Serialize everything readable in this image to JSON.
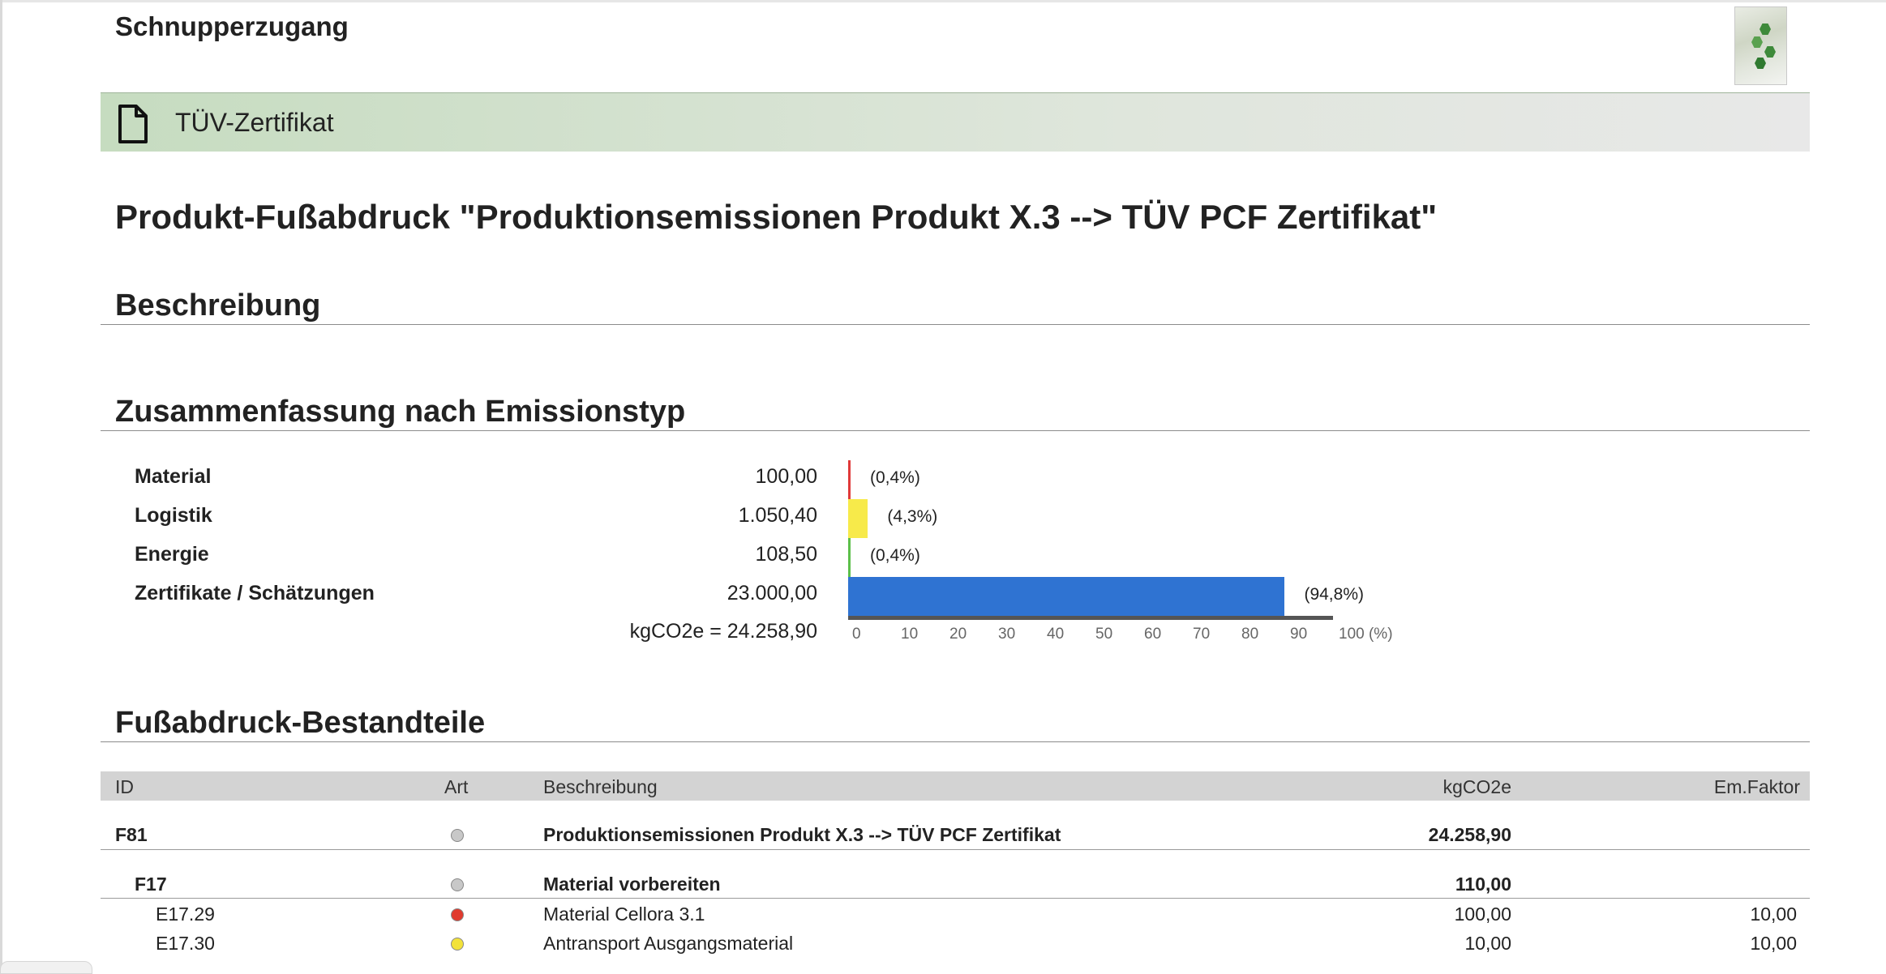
{
  "header": {
    "account_title": "Schnupperzugang"
  },
  "document": {
    "type_label": "TÜV-Zertifikat"
  },
  "page_title": "Produkt-Fußabdruck \"Produktionsemissionen Produkt X.3 --> TÜV PCF Zertifikat\"",
  "sections": {
    "description": "Beschreibung",
    "summary": "Zusammenfassung nach Emissionstyp",
    "components": "Fußabdruck-Bestandteile"
  },
  "summary": {
    "rows": [
      {
        "label": "Material",
        "value": "100,00",
        "percent_text": "(0,4%)",
        "percent": 0.4,
        "color": "#e03a3a"
      },
      {
        "label": "Logistik",
        "value": "1.050,40",
        "percent_text": "(4,3%)",
        "percent": 4.3,
        "color": "#f7ea4a"
      },
      {
        "label": "Energie",
        "value": "108,50",
        "percent_text": "(0,4%)",
        "percent": 0.4,
        "color": "#5cbf4a"
      },
      {
        "label": "Zertifikate / Schätzungen",
        "value": "23.000,00",
        "percent_text": "(94,8%)",
        "percent": 94.8,
        "color": "#2f73d2"
      }
    ],
    "total": "kgCO2e = 24.258,90",
    "axis_ticks": [
      "0",
      "10",
      "20",
      "30",
      "40",
      "50",
      "60",
      "70",
      "80",
      "90",
      "100 (%)"
    ]
  },
  "table": {
    "columns": [
      "ID",
      "Art",
      "Beschreibung",
      "kgCO2e",
      "Em.Faktor"
    ],
    "rows": [
      {
        "id": "F81",
        "art_color": "#c8c8c8",
        "description": "Produktionsemissionen Produkt X.3 --> TÜV PCF Zertifikat",
        "kgco2e": "24.258,90",
        "factor": ""
      },
      {
        "id": "F17",
        "art_color": "#c8c8c8",
        "description": "Material vorbereiten",
        "kgco2e": "110,00",
        "factor": ""
      },
      {
        "id": "E17.29",
        "art_color": "#e03a2e",
        "description": "Material Cellora 3.1",
        "kgco2e": "100,00",
        "factor": "10,00"
      },
      {
        "id": "E17.30",
        "art_color": "#f2e23a",
        "description": "Antransport Ausgangsmaterial",
        "kgco2e": "10,00",
        "factor": "10,00"
      }
    ]
  }
}
